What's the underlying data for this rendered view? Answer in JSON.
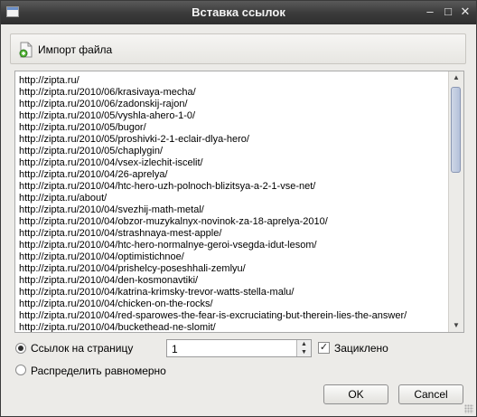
{
  "window": {
    "title": "Вставка ссылок",
    "controls": {
      "minimize": "–",
      "maximize": "□",
      "close": "✕"
    }
  },
  "toolbar": {
    "import_label": "Импорт файла",
    "import_icon": "import-file-icon"
  },
  "links": [
    "http://zipta.ru/",
    "http://zipta.ru/2010/06/krasivaya-mecha/",
    "http://zipta.ru/2010/06/zadonskij-rajon/",
    "http://zipta.ru/2010/05/vyshla-ahero-1-0/",
    "http://zipta.ru/2010/05/bugor/",
    "http://zipta.ru/2010/05/proshivki-2-1-eclair-dlya-hero/",
    "http://zipta.ru/2010/05/chaplygin/",
    "http://zipta.ru/2010/04/vsex-izlechit-iscelit/",
    "http://zipta.ru/2010/04/26-aprelya/",
    "http://zipta.ru/2010/04/htc-hero-uzh-polnoch-blizitsya-a-2-1-vse-net/",
    "http://zipta.ru/about/",
    "http://zipta.ru/2010/04/svezhij-math-metal/",
    "http://zipta.ru/2010/04/obzor-muzykalnyx-novinok-za-18-aprelya-2010/",
    "http://zipta.ru/2010/04/strashnaya-mest-apple/",
    "http://zipta.ru/2010/04/htc-hero-normalnye-geroi-vsegda-idut-lesom/",
    "http://zipta.ru/2010/04/optimistichnoe/",
    "http://zipta.ru/2010/04/prishelcy-poseshhali-zemlyu/",
    "http://zipta.ru/2010/04/den-kosmonavtiki/",
    "http://zipta.ru/2010/04/katrina-krimsky-trevor-watts-stella-malu/",
    "http://zipta.ru/2010/04/chicken-on-the-rocks/",
    "http://zipta.ru/2010/04/red-sparowes-the-fear-is-excruciating-but-therein-lies-the-answer/",
    "http://zipta.ru/2010/04/buckethead-ne-slomit/"
  ],
  "options": {
    "per_page_label": "Ссылок на страницу",
    "per_page_value": "1",
    "loop_label": "Зациклено",
    "loop_checked": "✓",
    "distribute_label": "Распределить равномерно"
  },
  "buttons": {
    "ok": "OK",
    "cancel": "Cancel"
  }
}
